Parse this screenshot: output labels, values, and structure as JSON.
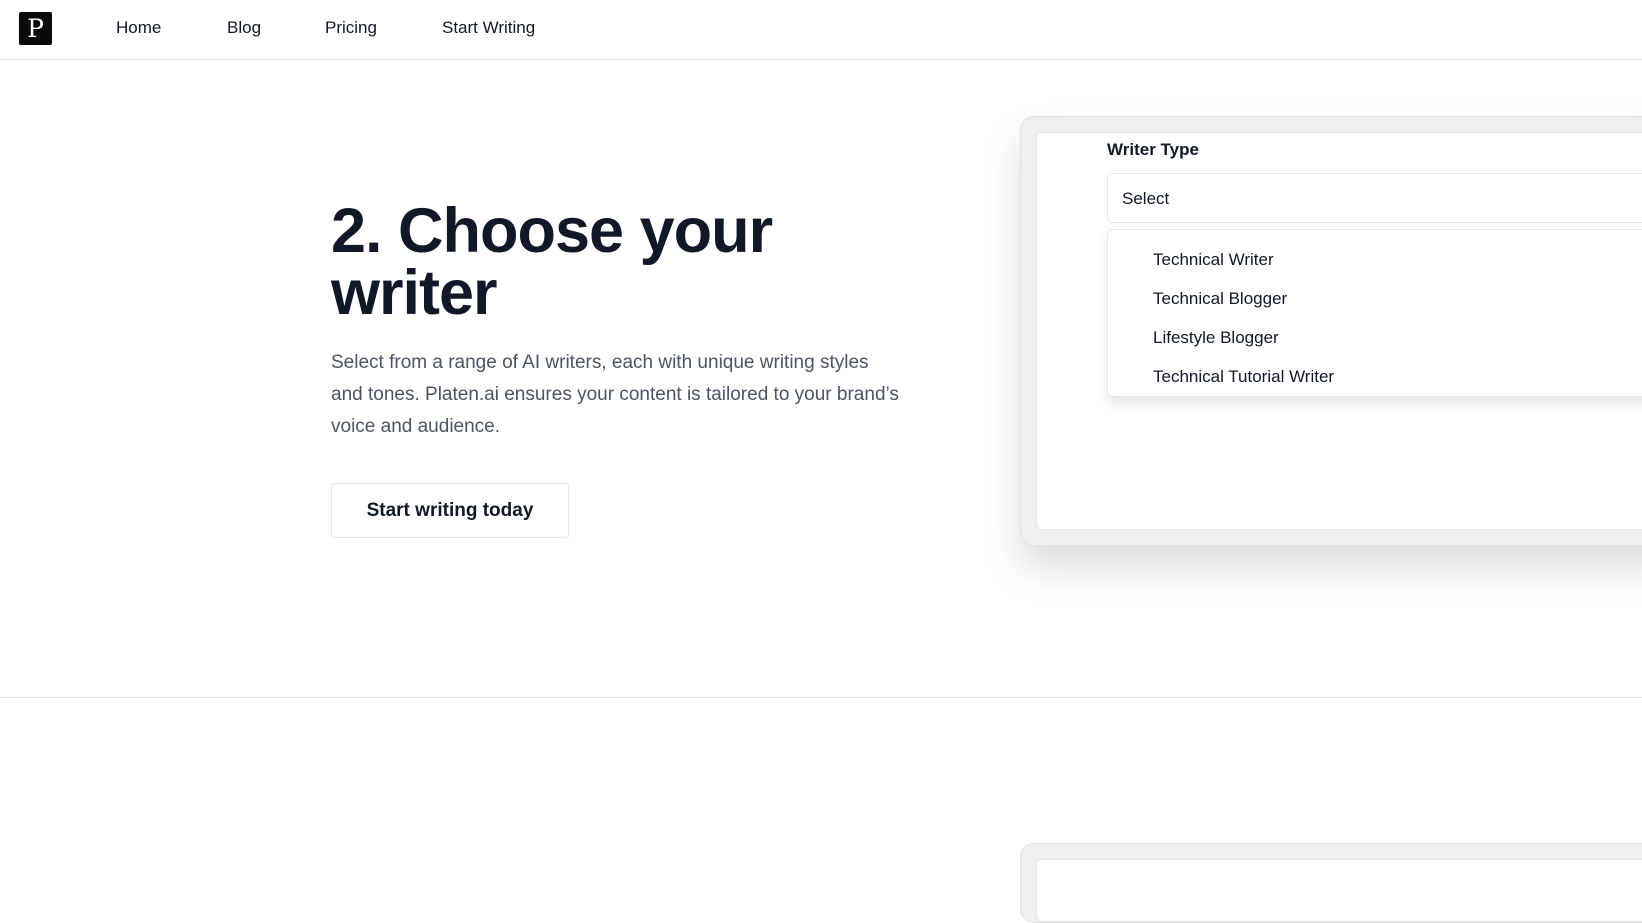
{
  "nav": {
    "logo_letter": "P",
    "links": [
      "Home",
      "Blog",
      "Pricing",
      "Start Writing"
    ]
  },
  "hero": {
    "title": "2. Choose your writer",
    "description": "Select from a range of AI writers, each with unique writing styles and tones. Platen.ai ensures your content is tailored to your brand’s voice and audience.",
    "cta_label": "Start writing today"
  },
  "writer_panel": {
    "field_label": "Writer Type",
    "select_value": "Select",
    "options": [
      "Technical Writer",
      "Technical Blogger",
      "Lifestyle Blogger",
      "Technical Tutorial Writer"
    ]
  }
}
